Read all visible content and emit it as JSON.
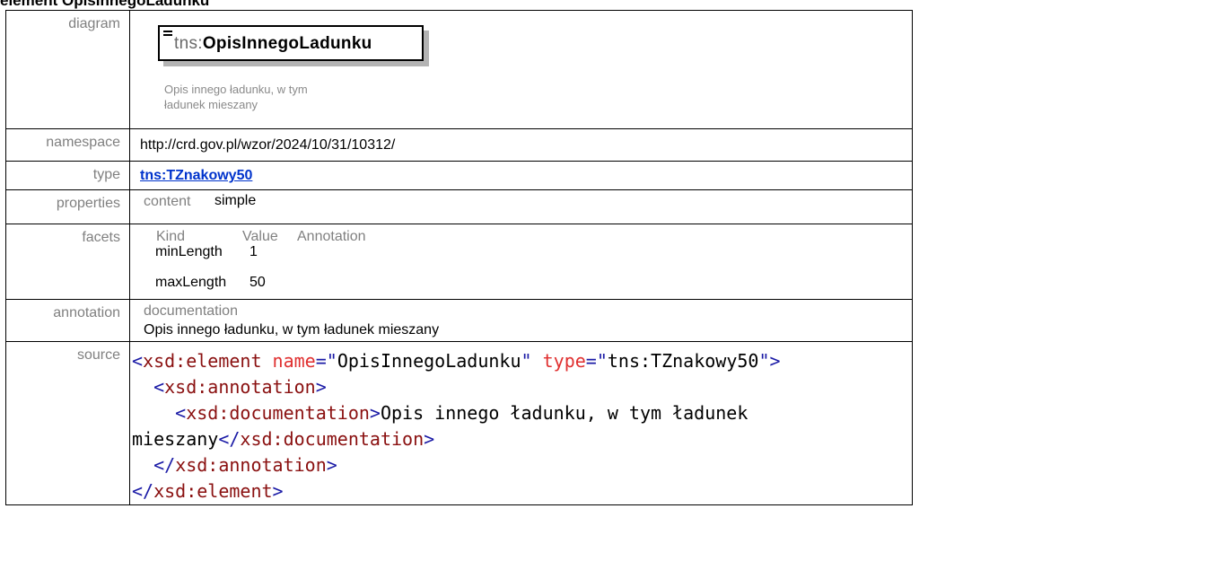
{
  "heading": "element OpisInnegoLadunku",
  "labels": {
    "diagram": "diagram",
    "namespace": "namespace",
    "type": "type",
    "properties": "properties",
    "facets": "facets",
    "annotation": "annotation",
    "source": "source"
  },
  "diagram": {
    "prefix": "tns:",
    "name": "OpisInnegoLadunku",
    "doc_line1": "Opis innego ładunku, w tym",
    "doc_line2": "ładunek mieszany"
  },
  "namespace": "http://crd.gov.pl/wzor/2024/10/31/10312/",
  "type": "tns:TZnakowy50",
  "properties": {
    "key": "content",
    "value": "simple"
  },
  "facets": {
    "headers": [
      "Kind",
      "Value",
      "Annotation"
    ],
    "rows": [
      {
        "kind": "minLength",
        "value": "1"
      },
      {
        "kind": "maxLength",
        "value": "50"
      }
    ]
  },
  "annotation": {
    "header": "documentation",
    "text": "Opis innego ładunku, w tym ładunek mieszany"
  },
  "source": {
    "l1_open": "<",
    "l1_tag": "xsd:element",
    "l1_attr1": "name",
    "l1_eq1": "=\"",
    "l1_val1": "OpisInnegoLadunku",
    "l1_q1": "\"",
    "l1_attr2": "type",
    "l1_eq2": "=\"",
    "l1_val2": "tns:TZnakowy50",
    "l1_close": "\">",
    "l2_open": "<",
    "l2_tag": "xsd:annotation",
    "l2_close": ">",
    "l3_open": "<",
    "l3_tag": "xsd:documentation",
    "l3_close": ">",
    "l3_text": "Opis innego ładunku, w tym ładunek",
    "l4_text": "mieszany",
    "l4_open": "</",
    "l4_tag": "xsd:documentation",
    "l4_close": ">",
    "l5_open": "</",
    "l5_tag": "xsd:annotation",
    "l5_close": ">",
    "l6_open": "</",
    "l6_tag": "xsd:element",
    "l6_close": ">"
  },
  "colors": {
    "link": "#0033cc",
    "label_gray": "#808080",
    "tag_blue": "#1a1aa6",
    "tagname_red": "#8a1010",
    "attr_red": "#e03030"
  }
}
